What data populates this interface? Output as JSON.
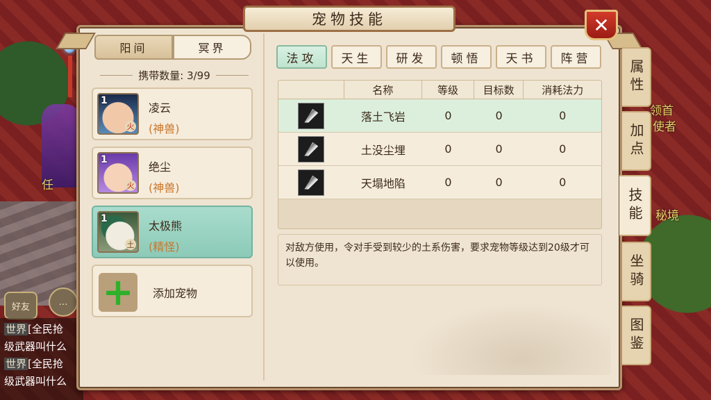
{
  "window": {
    "title": "宠物技能",
    "close_icon": "close-icon"
  },
  "world": {
    "label_leader": "领首",
    "label_envoy": "使者",
    "label_secret": "秘境",
    "label_ren": "任",
    "chat": [
      {
        "tag": "世界",
        "text": "[全民抢",
        "line2": "级武器叫什么"
      },
      {
        "tag": "世界",
        "text": "[全民抢",
        "line2": "级武器叫什么"
      }
    ],
    "friends_label": "好友"
  },
  "realm_tabs": [
    {
      "label": "阳间",
      "active": true
    },
    {
      "label": "冥界",
      "active": false
    }
  ],
  "carry": {
    "label": "携带数量: 3/99"
  },
  "pets": [
    {
      "level": "1",
      "name": "凌云",
      "type": "(神兽)",
      "element": "火",
      "selected": false
    },
    {
      "level": "1",
      "name": "绝尘",
      "type": "(神兽)",
      "element": "火",
      "selected": false
    },
    {
      "level": "1",
      "name": "太极熊",
      "type": "(精怪)",
      "element": "土",
      "selected": true
    }
  ],
  "add_pet": {
    "label": "添加宠物"
  },
  "skill_tabs": [
    {
      "label": "法攻",
      "active": true
    },
    {
      "label": "天生",
      "active": false
    },
    {
      "label": "研发",
      "active": false
    },
    {
      "label": "顿悟",
      "active": false
    },
    {
      "label": "天书",
      "active": false
    },
    {
      "label": "阵营",
      "active": false
    }
  ],
  "table": {
    "headers": [
      "",
      "名称",
      "等级",
      "目标数",
      "消耗法力"
    ],
    "rows": [
      {
        "name": "落土飞岩",
        "level": "0",
        "targets": "0",
        "mana": "0",
        "selected": true
      },
      {
        "name": "土没尘埋",
        "level": "0",
        "targets": "0",
        "mana": "0",
        "selected": false
      },
      {
        "name": "天塌地陷",
        "level": "0",
        "targets": "0",
        "mana": "0",
        "selected": false
      }
    ]
  },
  "description": "对敌方使用，令对手受到较少的土系伤害，要求宠物等级达到20级才可以使用。",
  "side_tabs": [
    {
      "label": "属性",
      "active": false
    },
    {
      "label": "加点",
      "active": false
    },
    {
      "label": "技能",
      "active": true
    },
    {
      "label": "坐骑",
      "active": false
    },
    {
      "label": "图鉴",
      "active": false
    }
  ],
  "colors": {
    "accent_green": "#bfe4cf",
    "close_red": "#c42a1e",
    "pet_type": "#c9762a"
  }
}
